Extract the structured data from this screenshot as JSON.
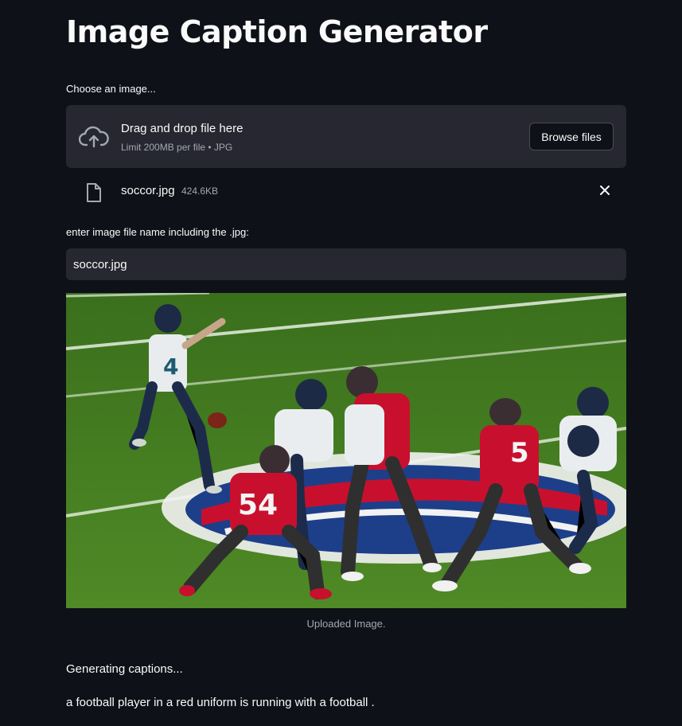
{
  "app": {
    "title": "Image Caption Generator"
  },
  "uploader": {
    "label": "Choose an image...",
    "drop_title": "Drag and drop file here",
    "limit_text": "Limit 200MB per file • JPG",
    "browse_label": "Browse files",
    "upload_icon": "cloud-upload-icon"
  },
  "uploaded_file": {
    "name": "soccor.jpg",
    "size": "424.6KB",
    "file_icon": "file-icon",
    "remove_icon": "close-icon"
  },
  "filename_input": {
    "label": "enter image file name including the .jpg:",
    "value": "soccor.jpg"
  },
  "image": {
    "caption": "Uploaded Image.",
    "description_hint": "photo of american football players on a field"
  },
  "output": {
    "status": "Generating captions...",
    "result": "a football player in a red uniform is running with a football ."
  },
  "colors": {
    "background": "#0e1117",
    "widget": "#262730",
    "text": "#fafafa",
    "muted": "#a3a8b4"
  }
}
